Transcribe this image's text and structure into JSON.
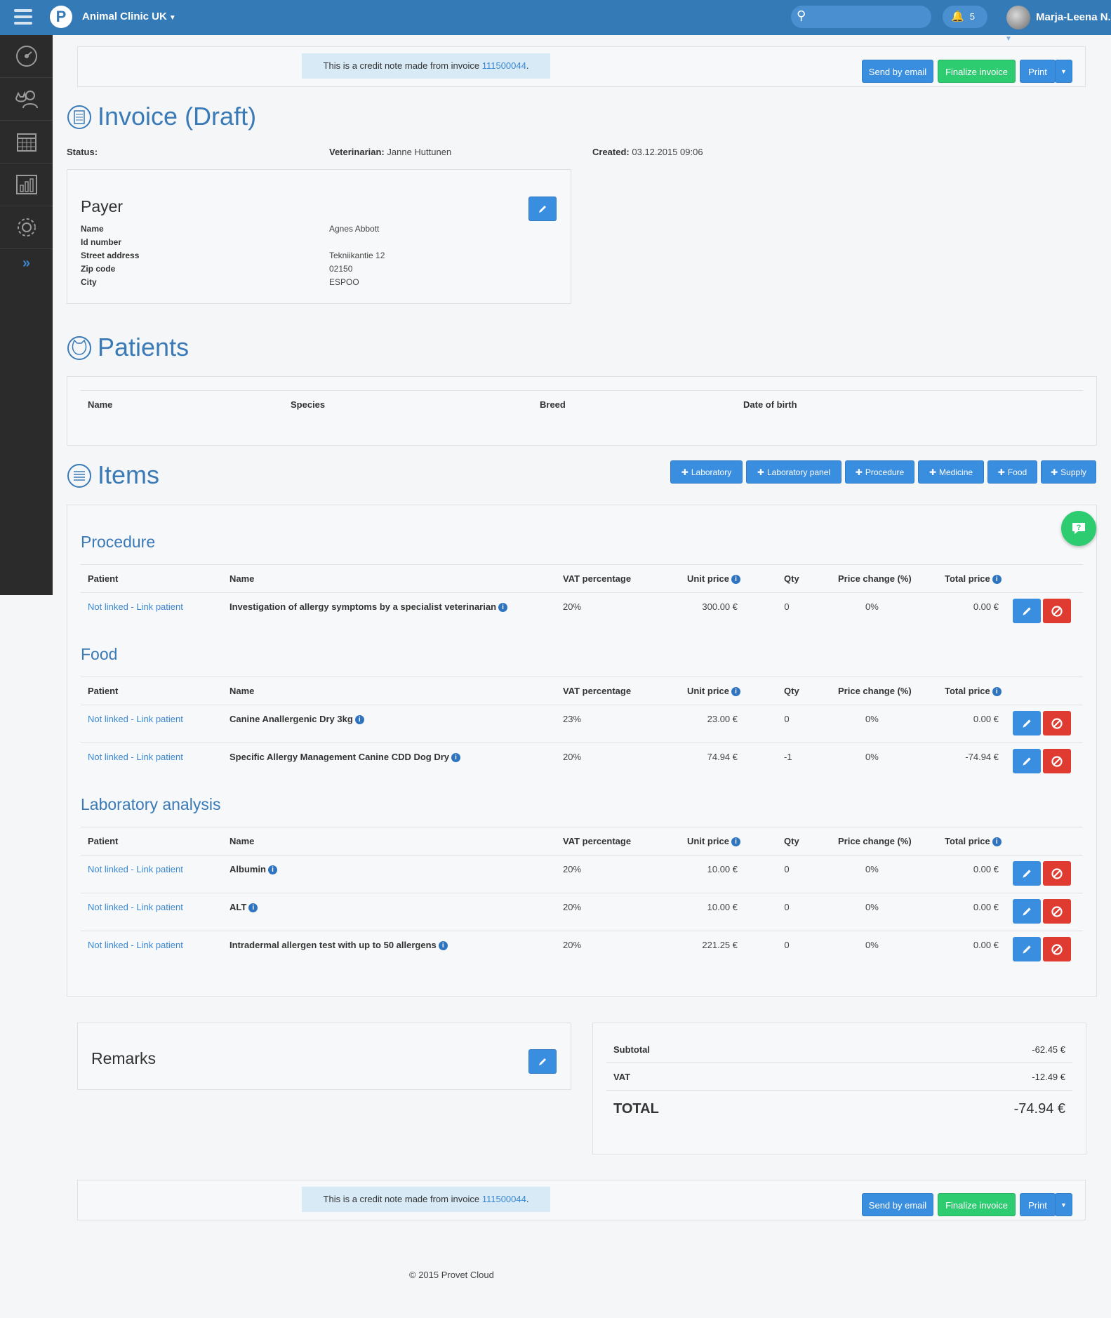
{
  "topbar": {
    "clinic_name": "Animal Clinic UK",
    "search_placeholder": "",
    "notifications_count": "5",
    "user_name": "Marja-Leena N."
  },
  "sidebar": {
    "items": [
      "dashboard-icon",
      "clients-icon",
      "calendar-icon",
      "reports-icon",
      "settings-icon"
    ],
    "expand_label": "»"
  },
  "action_bar": {
    "notice_text": "This is a credit note made from invoice",
    "notice_invoice": "111500044",
    "notice_period": ".",
    "send_email": "Send by email",
    "finalize": "Finalize invoice",
    "print": "Print"
  },
  "invoice": {
    "title": "Invoice (Draft)",
    "status_label": "Status:",
    "status_value": "",
    "vet_label": "Veterinarian:",
    "vet_value": "Janne Huttunen",
    "created_label": "Created:",
    "created_value": "03.12.2015 09:06"
  },
  "payer": {
    "title": "Payer",
    "fields": [
      {
        "label": "Name",
        "value": "Agnes Abbott"
      },
      {
        "label": "Id number",
        "value": ""
      },
      {
        "label": "Street address",
        "value": "Tekniikantie 12"
      },
      {
        "label": "Zip code",
        "value": "02150"
      },
      {
        "label": "City",
        "value": "ESPOO"
      }
    ]
  },
  "patients": {
    "title": "Patients",
    "columns": [
      "Name",
      "Species",
      "Breed",
      "Date of birth"
    ]
  },
  "items": {
    "title": "Items",
    "add_buttons": [
      "Laboratory",
      "Laboratory panel",
      "Procedure",
      "Medicine",
      "Food",
      "Supply"
    ],
    "columns": [
      "Patient",
      "Name",
      "VAT percentage",
      "Unit price",
      "Qty",
      "Price change (%)",
      "Total price"
    ],
    "patient_link": "Not linked - Link patient",
    "groups": [
      {
        "title": "Procedure",
        "rows": [
          {
            "name": "Investigation of allergy symptoms by a specialist veterinarian",
            "vat": "20%",
            "unit_price": "300.00 €",
            "qty": "0",
            "price_change": "0%",
            "total": "0.00 €"
          }
        ]
      },
      {
        "title": "Food",
        "rows": [
          {
            "name": "Canine Anallergenic Dry 3kg",
            "vat": "23%",
            "unit_price": "23.00 €",
            "qty": "0",
            "price_change": "0%",
            "total": "0.00 €"
          },
          {
            "name": "Specific Allergy Management Canine CDD Dog Dry",
            "vat": "20%",
            "unit_price": "74.94 €",
            "qty": "-1",
            "price_change": "0%",
            "total": "-74.94 €"
          }
        ]
      },
      {
        "title": "Laboratory analysis",
        "rows": [
          {
            "name": "Albumin",
            "vat": "20%",
            "unit_price": "10.00 €",
            "qty": "0",
            "price_change": "0%",
            "total": "0.00 €"
          },
          {
            "name": "ALT",
            "vat": "20%",
            "unit_price": "10.00 €",
            "qty": "0",
            "price_change": "0%",
            "total": "0.00 €"
          },
          {
            "name": "Intradermal allergen test with up to 50 allergens",
            "vat": "20%",
            "unit_price": "221.25 €",
            "qty": "0",
            "price_change": "0%",
            "total": "0.00 €"
          }
        ]
      }
    ]
  },
  "remarks": {
    "title": "Remarks"
  },
  "totals": {
    "subtotal_label": "Subtotal",
    "subtotal_value": "-62.45 €",
    "vat_label": "VAT",
    "vat_value": "-12.49 €",
    "total_label": "TOTAL",
    "total_value": "-74.94 €"
  },
  "footer": {
    "text": "© 2015 Provet Cloud"
  },
  "colors": {
    "brand": "#337ab7",
    "accent": "#3a8ee0",
    "success": "#2ecc71",
    "danger": "#e03b30",
    "sidebar": "#2b2b2b"
  }
}
